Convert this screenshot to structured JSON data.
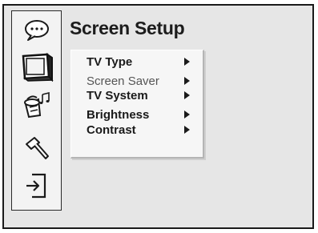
{
  "screen": {
    "title": "Screen Setup"
  },
  "sidebar": {
    "items": [
      {
        "icon": "speech-bubble-icon"
      },
      {
        "icon": "tv-screen-icon"
      },
      {
        "icon": "speaker-music-icon"
      },
      {
        "icon": "hammer-icon"
      },
      {
        "icon": "exit-door-icon"
      }
    ]
  },
  "menu": {
    "items": [
      {
        "label": "TV Type",
        "style": "bold"
      },
      {
        "label": "Screen Saver",
        "style": "dim"
      },
      {
        "label": "TV System",
        "style": "bold"
      },
      {
        "label": "Brightness",
        "style": "bold"
      },
      {
        "label": "Contrast",
        "style": "bold"
      }
    ]
  }
}
